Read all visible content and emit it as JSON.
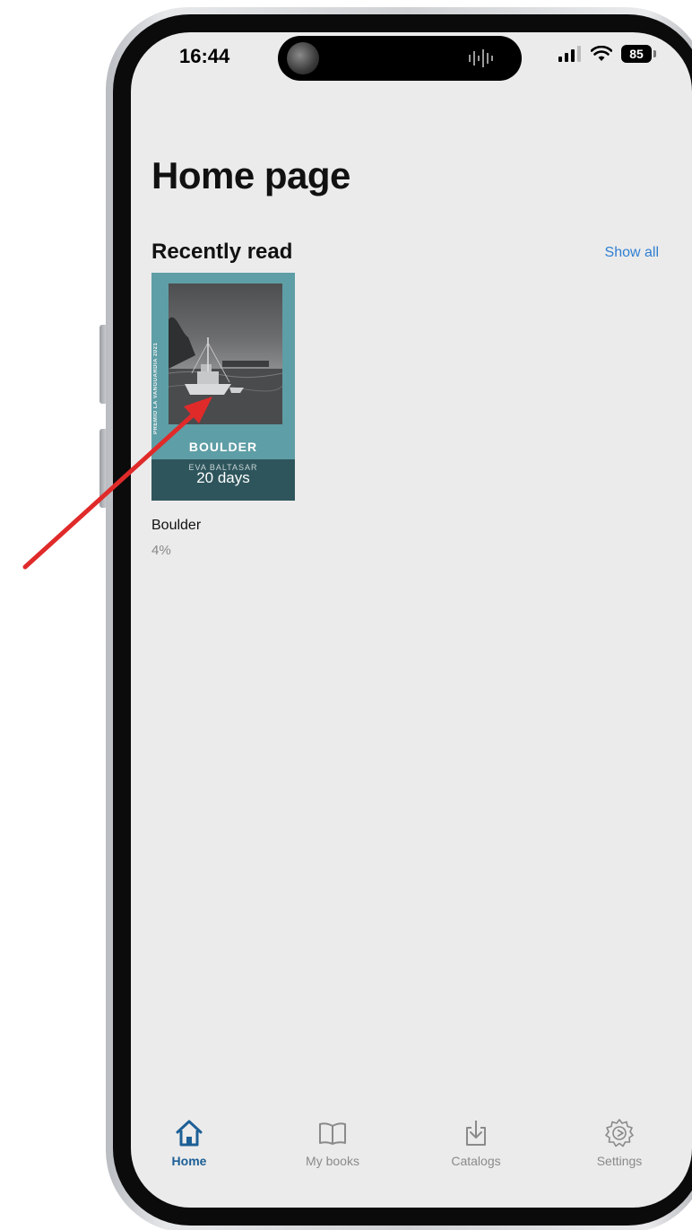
{
  "status_bar": {
    "time": "16:44",
    "battery": "85"
  },
  "home": {
    "title": "Home page"
  },
  "recently_read": {
    "title": "Recently read",
    "show_all": "Show all",
    "books": [
      {
        "name": "Boulder",
        "progress": "4%",
        "cover_title": "BOULDER",
        "cover_author": "EVA BALTASAR",
        "cover_spine": "PREMIO LA VANGUARDIA 2021",
        "time_label": "20 days"
      }
    ]
  },
  "tabs": [
    {
      "label": "Home",
      "icon": "home-icon",
      "active": true
    },
    {
      "label": "My books",
      "icon": "open-book-icon",
      "active": false
    },
    {
      "label": "Catalogs",
      "icon": "download-icon",
      "active": false
    },
    {
      "label": "Settings",
      "icon": "gear-icon",
      "active": false
    }
  ],
  "colors": {
    "accent": "#1c5f96",
    "link": "#2f7fd1",
    "screen_bg": "#ebebeb",
    "cover_teal": "#5e9ea6",
    "annotation_arrow": "#e02a2a"
  }
}
